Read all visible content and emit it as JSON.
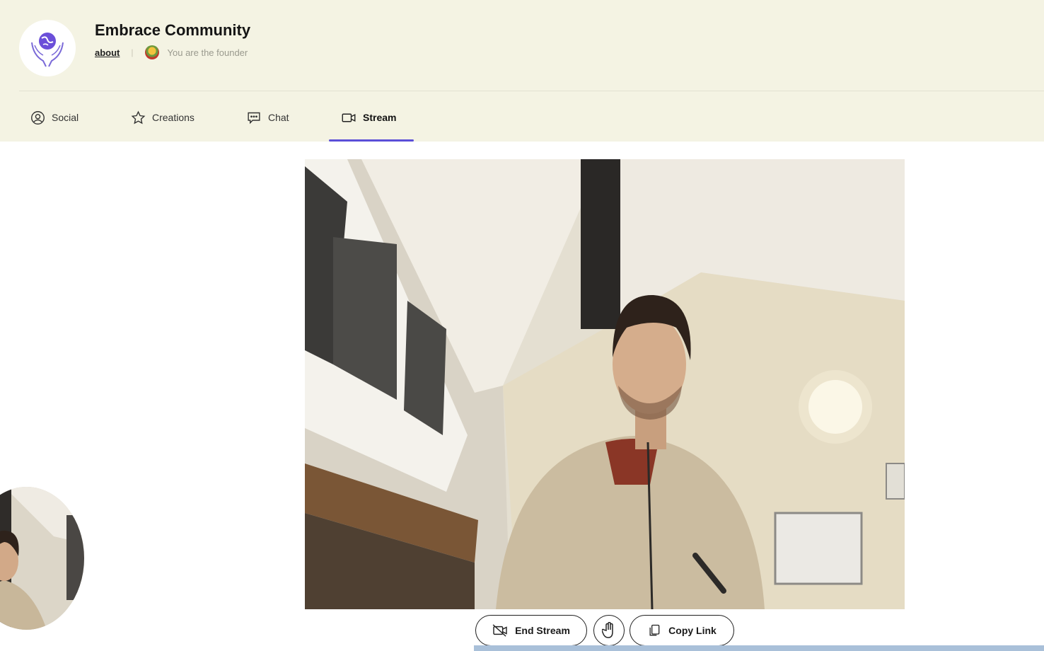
{
  "community": {
    "name": "Embrace Community",
    "about_link": "about",
    "role_text": "You are the founder",
    "logo_icon": "globe-hands-icon"
  },
  "tabs": [
    {
      "label": "Social",
      "icon": "user-circle-icon",
      "active": false
    },
    {
      "label": "Creations",
      "icon": "star-icon",
      "active": false
    },
    {
      "label": "Chat",
      "icon": "chat-bubble-icon",
      "active": false
    },
    {
      "label": "Stream",
      "icon": "video-camera-icon",
      "active": true
    }
  ],
  "stream": {
    "main_video": "remote-participant-video",
    "self_view": "local-camera-preview"
  },
  "controls": {
    "end_stream_label": "End Stream",
    "raise_hand_icon": "hand-icon",
    "copy_link_label": "Copy Link"
  },
  "colors": {
    "header_bg": "#f4f3e3",
    "accent": "#5b4fd8"
  }
}
